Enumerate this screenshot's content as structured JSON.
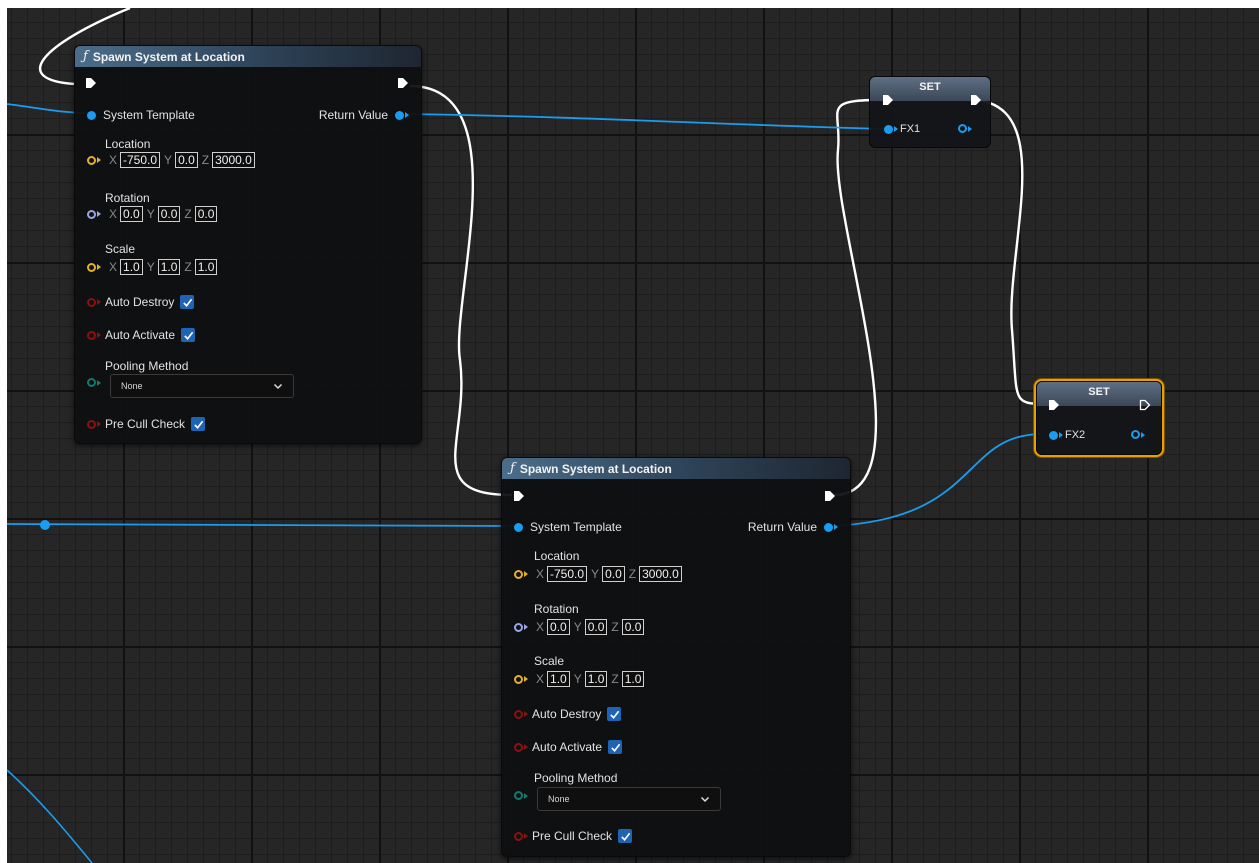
{
  "graph": {
    "node1": {
      "title": "Spawn System at Location",
      "func_icon": "ƒ",
      "system_template": "System Template",
      "return_value": "Return Value",
      "location_label": "Location",
      "location": {
        "x_axis": "X",
        "x": "-750.0",
        "y_axis": "Y",
        "y": "0.0",
        "z_axis": "Z",
        "z": "3000.0"
      },
      "rotation_label": "Rotation",
      "rotation": {
        "x_axis": "X",
        "x": "0.0",
        "y_axis": "Y",
        "y": "0.0",
        "z_axis": "Z",
        "z": "0.0"
      },
      "scale_label": "Scale",
      "scale": {
        "x_axis": "X",
        "x": "1.0",
        "y_axis": "Y",
        "y": "1.0",
        "z_axis": "Z",
        "z": "1.0"
      },
      "auto_destroy": "Auto Destroy",
      "auto_activate": "Auto Activate",
      "pooling_method": "Pooling Method",
      "pooling_value": "None",
      "pre_cull_check": "Pre Cull Check"
    },
    "node2": {
      "title": "Spawn System at Location",
      "func_icon": "ƒ",
      "system_template": "System Template",
      "return_value": "Return Value",
      "location_label": "Location",
      "location": {
        "x_axis": "X",
        "x": "-750.0",
        "y_axis": "Y",
        "y": "0.0",
        "z_axis": "Z",
        "z": "3000.0"
      },
      "rotation_label": "Rotation",
      "rotation": {
        "x_axis": "X",
        "x": "0.0",
        "y_axis": "Y",
        "y": "0.0",
        "z_axis": "Z",
        "z": "0.0"
      },
      "scale_label": "Scale",
      "scale": {
        "x_axis": "X",
        "x": "1.0",
        "y_axis": "Y",
        "y": "1.0",
        "z_axis": "Z",
        "z": "1.0"
      },
      "auto_destroy": "Auto Destroy",
      "auto_activate": "Auto Activate",
      "pooling_method": "Pooling Method",
      "pooling_value": "None",
      "pre_cull_check": "Pre Cull Check"
    },
    "set1": {
      "title": "SET",
      "var": "FX1"
    },
    "set2": {
      "title": "SET",
      "var": "FX2"
    }
  },
  "colors": {
    "exec_wire": "#ffffff",
    "object_wire": "#1a9cf0",
    "selection": "#e8a000"
  },
  "icons": [
    "exec-pin-icon",
    "object-pin-icon",
    "vector-pin-icon",
    "rotator-pin-icon",
    "bool-pin-icon",
    "enum-pin-icon",
    "checkbox-check-icon",
    "chevron-down-icon",
    "function-icon"
  ]
}
